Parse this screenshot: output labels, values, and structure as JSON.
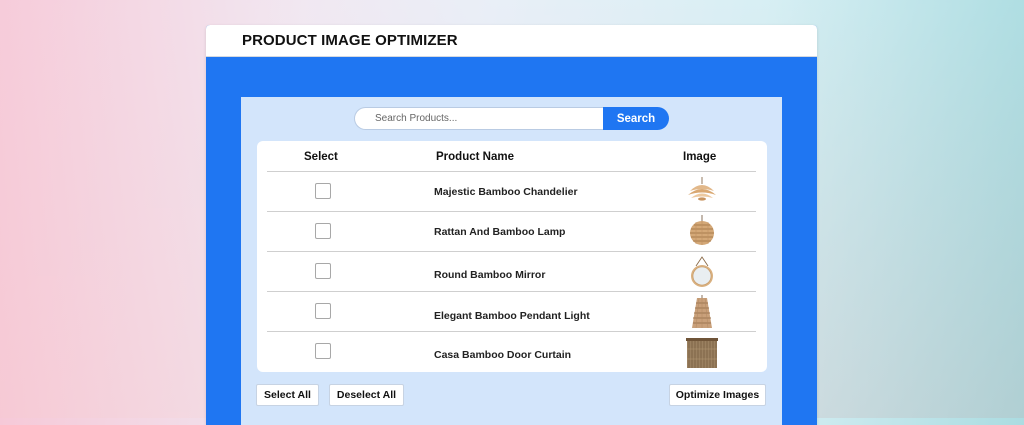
{
  "app": {
    "title": "PRODUCT IMAGE OPTIMIZER"
  },
  "search": {
    "placeholder": "Search Products...",
    "button_label": "Search"
  },
  "table": {
    "columns": [
      "Select",
      "Product Name",
      "Image"
    ],
    "rows": [
      {
        "name": "Majestic Bamboo Chandelier",
        "selected": false,
        "image_icon": "bamboo-chandelier-icon"
      },
      {
        "name": "Rattan And Bamboo Lamp",
        "selected": false,
        "image_icon": "rattan-lamp-icon"
      },
      {
        "name": "Round Bamboo Mirror",
        "selected": false,
        "image_icon": "round-mirror-icon"
      },
      {
        "name": "Elegant Bamboo Pendant Light",
        "selected": false,
        "image_icon": "pendant-light-icon"
      },
      {
        "name": "Casa Bamboo Door Curtain",
        "selected": false,
        "image_icon": "door-curtain-icon"
      }
    ]
  },
  "actions": {
    "select_all": "Select All",
    "deselect_all": "Deselect All",
    "optimize": "Optimize Images"
  },
  "colors": {
    "primary": "#1f76f2",
    "panel": "#d3e5fb",
    "card": "#ffffff"
  }
}
